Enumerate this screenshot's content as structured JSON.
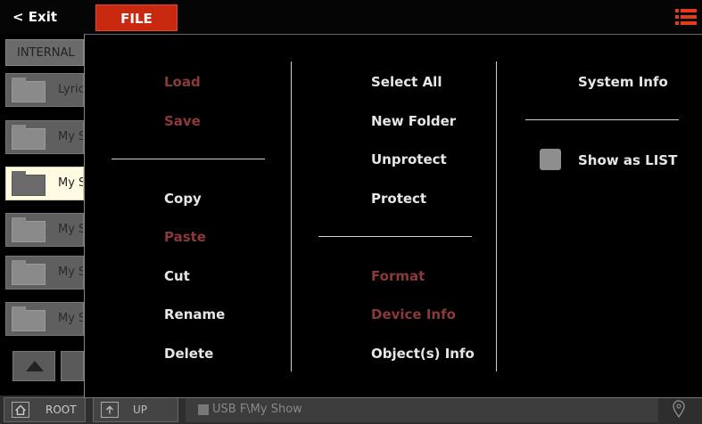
{
  "topbar": {
    "exit_label": "< Exit",
    "file_label": "FILE",
    "menu_icon": "hamburger-menu-icon",
    "accent_color": "#c8290f"
  },
  "browser": {
    "storage_tab": "INTERNAL",
    "rows": [
      {
        "name": "Lyric",
        "selected": false
      },
      {
        "name": "My S",
        "selected": false
      },
      {
        "name": "My S",
        "selected": true
      },
      {
        "name": "My S",
        "selected": false
      },
      {
        "name": "My S",
        "selected": false
      },
      {
        "name": "My S",
        "selected": false
      }
    ],
    "root_label": "ROOT",
    "up_label": "UP",
    "path": "USB F\\My Show"
  },
  "menu": {
    "col1": {
      "load": "Load",
      "save": "Save",
      "copy": "Copy",
      "paste": "Paste",
      "cut": "Cut",
      "rename": "Rename",
      "delete": "Delete"
    },
    "col2": {
      "select_all": "Select All",
      "new_folder": "New Folder",
      "unprotect": "Unprotect",
      "protect": "Protect",
      "format": "Format",
      "device_info": "Device Info",
      "objects_info": "Object(s) Info"
    },
    "col3": {
      "system_info": "System Info",
      "show_as_list": "Show as LIST",
      "show_as_list_checked": false
    },
    "disabled_color": "#8a3a3a"
  }
}
